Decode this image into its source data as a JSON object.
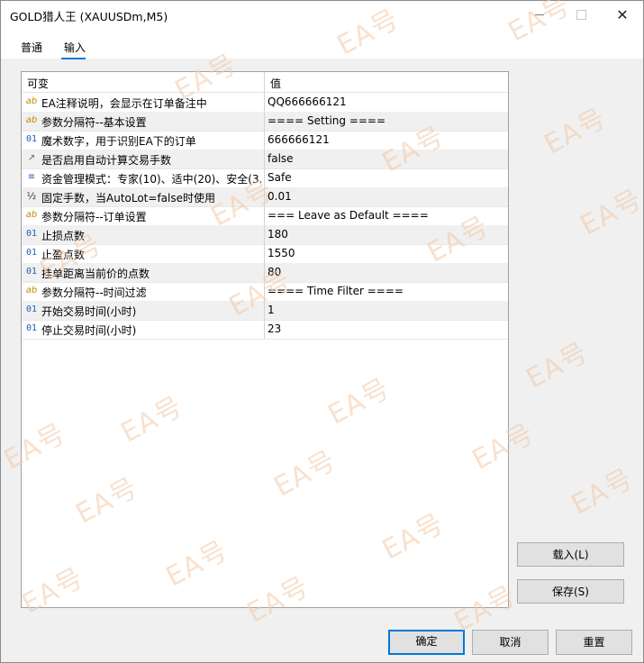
{
  "window": {
    "title": "GOLD猎人王 (XAUUSDm,M5)"
  },
  "tabs": [
    {
      "label": "普通"
    },
    {
      "label": "输入"
    }
  ],
  "grid": {
    "columns": {
      "name": "可变",
      "value": "值"
    },
    "rows": [
      {
        "icon": "ab",
        "name": "EA注释说明，会显示在订单备注中",
        "value": "QQ666666121"
      },
      {
        "icon": "ab",
        "name": "参数分隔符--基本设置",
        "value": "==== Setting ===="
      },
      {
        "icon": "01",
        "name": "魔术数字，用于识别EA下的订单",
        "value": "666666121"
      },
      {
        "icon": "↗",
        "name": "是否启用自动计算交易手数",
        "value": "false"
      },
      {
        "icon": "≡",
        "name": "资金管理模式：专家(10)、适中(20)、安全(3...",
        "value": "Safe"
      },
      {
        "icon": "½",
        "name": "固定手数，当AutoLot=false时使用",
        "value": "0.01"
      },
      {
        "icon": "ab",
        "name": "参数分隔符--订单设置",
        "value": "=== Leave as Default ===="
      },
      {
        "icon": "01",
        "name": "止损点数",
        "value": "180"
      },
      {
        "icon": "01",
        "name": "止盈点数",
        "value": "1550"
      },
      {
        "icon": "01",
        "name": "挂单距离当前价的点数",
        "value": "80"
      },
      {
        "icon": "ab",
        "name": "参数分隔符--时间过滤",
        "value": "==== Time Filter ===="
      },
      {
        "icon": "01",
        "name": "开始交易时间(小时)",
        "value": "1"
      },
      {
        "icon": "01",
        "name": "停止交易时间(小时)",
        "value": "23"
      }
    ]
  },
  "buttons": {
    "load": "载入(L)",
    "save": "保存(S)",
    "ok": "确定",
    "cancel": "取消",
    "reset": "重置"
  },
  "watermark": "EA号"
}
